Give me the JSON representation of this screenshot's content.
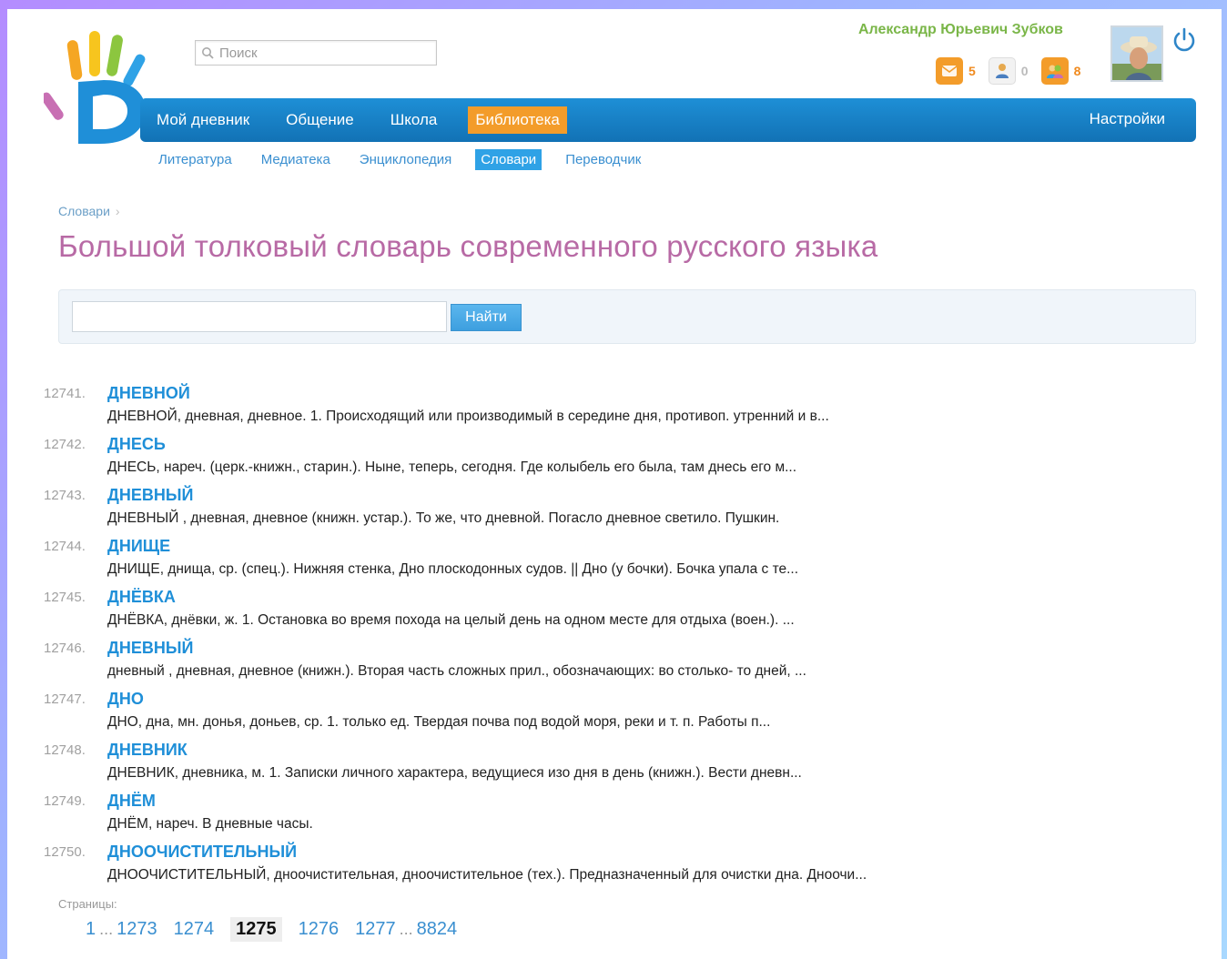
{
  "header": {
    "search_placeholder": "Поиск",
    "user_name": "Александр Юрьевич Зубков",
    "counters": [
      {
        "icon": "mail-icon",
        "count": "5",
        "style": "orange"
      },
      {
        "icon": "person-icon",
        "count": "0",
        "style": "gray"
      },
      {
        "icon": "people-icon",
        "count": "8",
        "style": "orange"
      }
    ]
  },
  "mainnav": {
    "items": [
      "Мой дневник",
      "Общение",
      "Школа",
      "Библиотека"
    ],
    "active_index": 3,
    "settings_label": "Настройки"
  },
  "subnav": {
    "items": [
      "Литература",
      "Медиатека",
      "Энциклопедия",
      "Словари",
      "Переводчик"
    ],
    "active_index": 3
  },
  "breadcrumb": {
    "label": "Словари",
    "separator": "›"
  },
  "page_title": "Большой толковый словарь современного русского языка",
  "dict_search": {
    "button_label": "Найти",
    "value": ""
  },
  "entries": [
    {
      "num": "12741.",
      "word": "ДНЕВНОЙ",
      "desc": "ДНЕВНОЙ, дневная, дневное. 1. Происходящий или производимый в середине дня, противоп. утренний и в..."
    },
    {
      "num": "12742.",
      "word": "ДНЕСЬ",
      "desc": "ДНЕСЬ, нареч. (церк.-книжн., старин.). Ныне, теперь, сегодня. Где колыбель его была, там днесь его м..."
    },
    {
      "num": "12743.",
      "word": "ДНЕВНЫЙ",
      "desc": "ДНЕВНЫЙ , дневная, дневное (книжн. устар.). То же, что дневной. Погасло дневное светило. Пушкин."
    },
    {
      "num": "12744.",
      "word": "ДНИЩЕ",
      "desc": "ДНИЩЕ, днища, ср. (спец.). Нижняя стенка, Дно плоскодонных судов. || Дно (у бочки). Бочка упала с те..."
    },
    {
      "num": "12745.",
      "word": "ДНЁВКА",
      "desc": "ДНЁВКА, днёвки, ж. 1. Остановка во время похода на целый день на одном месте для отдыха (воен.). ..."
    },
    {
      "num": "12746.",
      "word": "ДНЕВНЫЙ",
      "desc": "дневный , дневная, дневное (книжн.). Вторая часть сложных прил., обозначающих: во столько- то дней, ..."
    },
    {
      "num": "12747.",
      "word": "ДНО",
      "desc": "ДНО, дна, мн. донья, доньев, ср. 1. только ед. Твердая почва под водой моря, реки и т. п. Работы п..."
    },
    {
      "num": "12748.",
      "word": "ДНЕВНИК",
      "desc": "ДНЕВНИК, дневника, м. 1. Записки личного характера, ведущиеся изо дня в день (книжн.). Вести дневн..."
    },
    {
      "num": "12749.",
      "word": "ДНЁМ",
      "desc": "ДНЁМ, нареч. В дневные часы."
    },
    {
      "num": "12750.",
      "word": "ДНООЧИСТИТЕЛЬНЫЙ",
      "desc": "ДНООЧИСТИТЕЛЬНЫЙ, днoочистительная, днoочистительное (тех.). Предназначенный для очистки дна. Днoочи..."
    }
  ],
  "pagination": {
    "label": "Страницы:",
    "first": "1",
    "dots": "...",
    "pages": [
      "1273",
      "1274",
      "1275",
      "1276",
      "1277"
    ],
    "current": "1275",
    "last": "8824"
  }
}
